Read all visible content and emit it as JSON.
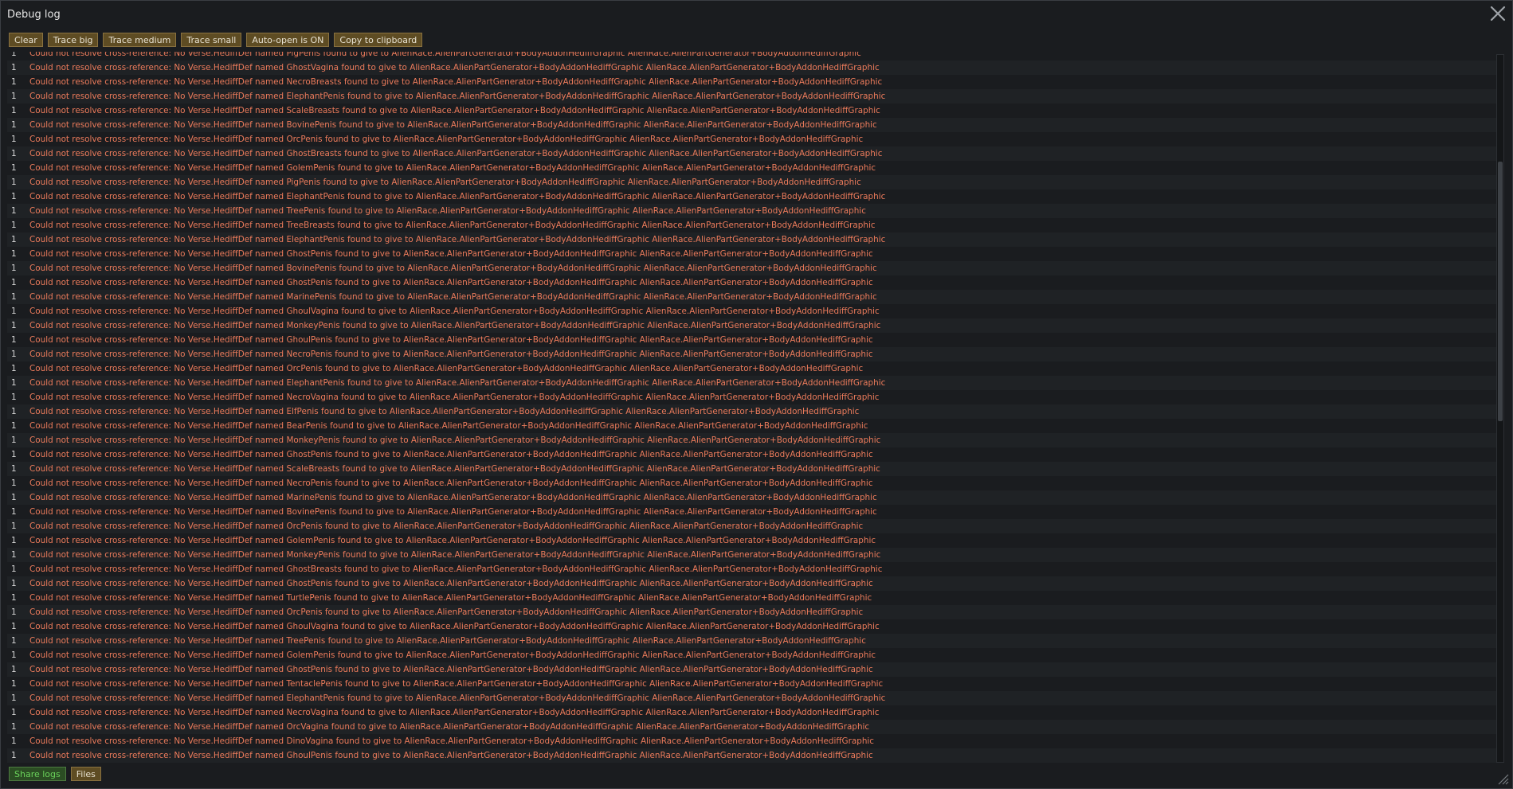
{
  "window": {
    "title": "Debug log",
    "close_icon": "close-icon",
    "resize_icon": "resize-grip-icon"
  },
  "toolbar": {
    "buttons": [
      "Clear",
      "Trace big",
      "Trace medium",
      "Trace small",
      "Auto-open is ON",
      "Copy to clipboard"
    ]
  },
  "bottom": {
    "share_label": "Share logs",
    "files_label": "Files"
  },
  "colors": {
    "error_text": "#ec7b5b",
    "button_bg": "#5e4c23",
    "share_text": "#69d05a"
  },
  "log": {
    "prefix": "Could not resolve cross-reference: No Verse.HediffDef named ",
    "suffix": " found to give to AlienRace.AlienPartGenerator+BodyAddonHediffGraphic AlienRace.AlienPartGenerator+BodyAddonHediffGraphic",
    "entries": [
      {
        "count": "1",
        "def": "PigPenis"
      },
      {
        "count": "1",
        "def": "GhostVagina"
      },
      {
        "count": "1",
        "def": "NecroBreasts"
      },
      {
        "count": "1",
        "def": "ElephantPenis"
      },
      {
        "count": "1",
        "def": "ScaleBreasts"
      },
      {
        "count": "1",
        "def": "BovinePenis"
      },
      {
        "count": "1",
        "def": "OrcPenis"
      },
      {
        "count": "1",
        "def": "GhostBreasts"
      },
      {
        "count": "1",
        "def": "GolemPenis"
      },
      {
        "count": "1",
        "def": "PigPenis"
      },
      {
        "count": "1",
        "def": "ElephantPenis"
      },
      {
        "count": "1",
        "def": "TreePenis"
      },
      {
        "count": "1",
        "def": "TreeBreasts"
      },
      {
        "count": "1",
        "def": "ElephantPenis"
      },
      {
        "count": "1",
        "def": "GhostPenis"
      },
      {
        "count": "1",
        "def": "BovinePenis"
      },
      {
        "count": "1",
        "def": "GhostPenis"
      },
      {
        "count": "1",
        "def": "MarinePenis"
      },
      {
        "count": "1",
        "def": "GhoulVagina"
      },
      {
        "count": "1",
        "def": "MonkeyPenis"
      },
      {
        "count": "1",
        "def": "GhoulPenis"
      },
      {
        "count": "1",
        "def": "NecroPenis"
      },
      {
        "count": "1",
        "def": "OrcPenis"
      },
      {
        "count": "1",
        "def": "ElephantPenis"
      },
      {
        "count": "1",
        "def": "NecroVagina"
      },
      {
        "count": "1",
        "def": "ElfPenis"
      },
      {
        "count": "1",
        "def": "BearPenis"
      },
      {
        "count": "1",
        "def": "MonkeyPenis"
      },
      {
        "count": "1",
        "def": "GhostPenis"
      },
      {
        "count": "1",
        "def": "ScaleBreasts"
      },
      {
        "count": "1",
        "def": "NecroPenis"
      },
      {
        "count": "1",
        "def": "MarinePenis"
      },
      {
        "count": "1",
        "def": "BovinePenis"
      },
      {
        "count": "1",
        "def": "OrcPenis"
      },
      {
        "count": "1",
        "def": "GolemPenis"
      },
      {
        "count": "1",
        "def": "MonkeyPenis"
      },
      {
        "count": "1",
        "def": "GhostBreasts"
      },
      {
        "count": "1",
        "def": "GhostPenis"
      },
      {
        "count": "1",
        "def": "TurtlePenis"
      },
      {
        "count": "1",
        "def": "OrcPenis"
      },
      {
        "count": "1",
        "def": "GhoulVagina"
      },
      {
        "count": "1",
        "def": "TreePenis"
      },
      {
        "count": "1",
        "def": "GolemPenis"
      },
      {
        "count": "1",
        "def": "GhostPenis"
      },
      {
        "count": "1",
        "def": "TentaclePenis"
      },
      {
        "count": "1",
        "def": "ElephantPenis"
      },
      {
        "count": "1",
        "def": "NecroVagina"
      },
      {
        "count": "1",
        "def": "OrcVagina"
      },
      {
        "count": "1",
        "def": "DinoVagina"
      },
      {
        "count": "1",
        "def": "GhoulPenis"
      }
    ]
  }
}
